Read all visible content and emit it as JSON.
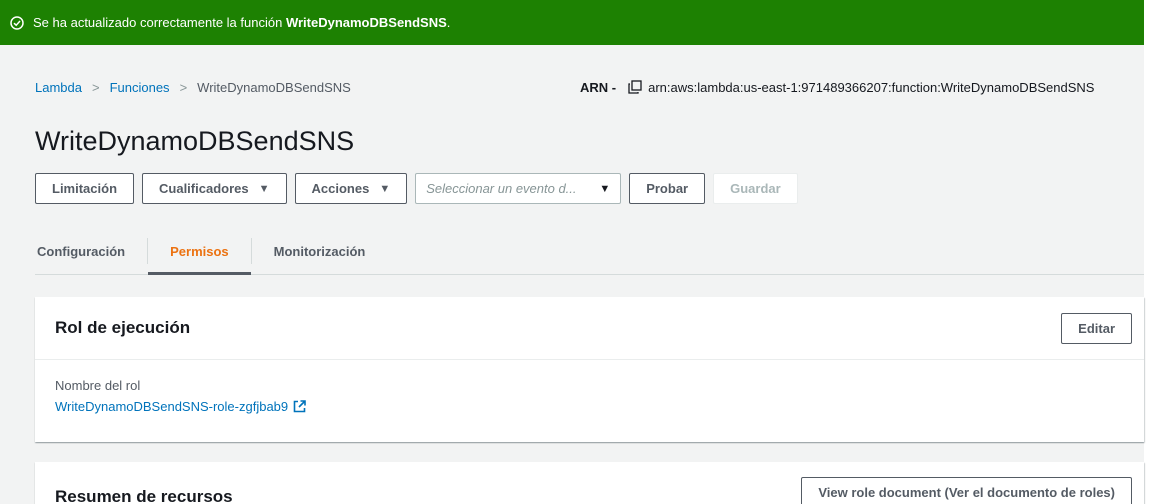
{
  "flash": {
    "prefix": "Se ha actualizado correctamente la función ",
    "function_name": "WriteDynamoDBSendSNS",
    "suffix": ".",
    "icon": "check-circle-icon",
    "color": "#1d8102"
  },
  "breadcrumb": {
    "items": [
      "Lambda",
      "Funciones",
      "WriteDynamoDBSendSNS"
    ],
    "separator": ">"
  },
  "arn": {
    "label": "ARN -",
    "value": "arn:aws:lambda:us-east-1:971489366207:function:WriteDynamoDBSendSNS"
  },
  "page_title": "WriteDynamoDBSendSNS",
  "toolbar": {
    "throttle_label": "Limitación",
    "qualifiers_label": "Cualificadores",
    "actions_label": "Acciones",
    "test_event_placeholder": "Seleccionar un evento d...",
    "test_label": "Probar",
    "save_label": "Guardar",
    "caret": "▼"
  },
  "tabs": [
    {
      "label": "Configuración",
      "active": false
    },
    {
      "label": "Permisos",
      "active": true
    },
    {
      "label": "Monitorización",
      "active": false
    }
  ],
  "execution_role": {
    "title": "Rol de ejecución",
    "edit_label": "Editar",
    "role_name_label": "Nombre del rol",
    "role_name": "WriteDynamoDBSendSNS-role-zgfjbab9"
  },
  "resource_summary": {
    "title": "Resumen de recursos",
    "view_role_label": "View role document (Ver el documento de roles)"
  },
  "colors": {
    "link": "#0073bb",
    "active_tab": "#ec7211",
    "background": "#f2f3f3"
  }
}
